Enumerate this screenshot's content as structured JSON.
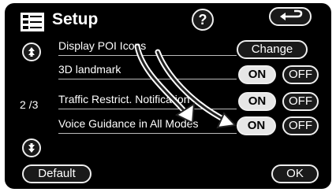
{
  "header": {
    "title": "Setup",
    "help_label": "?",
    "back_icon": "return-arrow-icon",
    "menu_icon": "setup-menu-icon"
  },
  "pagination": {
    "indicator": "2 /3"
  },
  "rows": [
    {
      "label": "Display POI Icons",
      "button": "Change"
    },
    {
      "label": "3D landmark",
      "on_label": "ON",
      "off_label": "OFF",
      "selected": "ON"
    },
    {
      "label": "Traffic Restrict. Notification",
      "on_label": "ON",
      "off_label": "OFF",
      "selected": "ON"
    },
    {
      "label": "Voice Guidance in All Modes",
      "on_label": "ON",
      "off_label": "OFF",
      "selected": "ON"
    }
  ],
  "footer": {
    "default_label": "Default",
    "ok_label": "OK"
  },
  "colors": {
    "background": "#000000",
    "text": "#ffffff",
    "button_selected": "#e6e6e6",
    "border": "#eeeeee"
  }
}
